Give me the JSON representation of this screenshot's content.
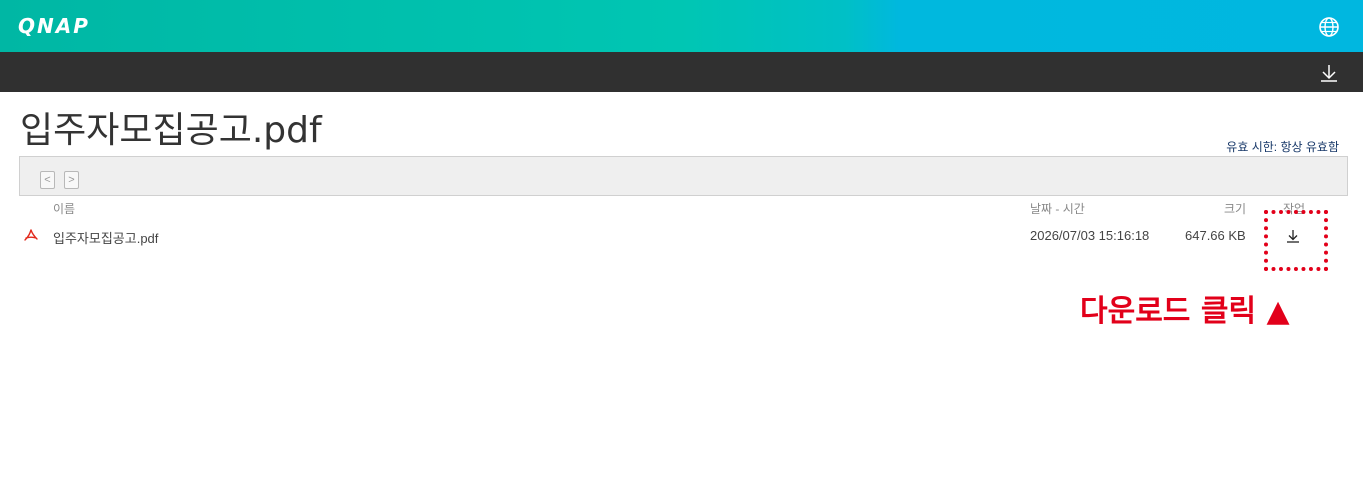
{
  "brand": {
    "logo_text": "QNAP"
  },
  "header": {
    "globe_icon": "globe-icon",
    "download_icon": "download-icon"
  },
  "page": {
    "title": "입주자모집공고.pdf",
    "expiry": "유효 시한: 항상 유효함"
  },
  "nav": {
    "prev_label": "<",
    "next_label": ">"
  },
  "table": {
    "columns": {
      "name": "이름",
      "datetime": "날짜 - 시간",
      "size": "크기",
      "action": "작업"
    },
    "rows": [
      {
        "icon": "pdf-icon",
        "name": "입주자모집공고.pdf",
        "datetime": "2026/07/03 15:16:18",
        "size": "647.66 KB"
      }
    ]
  },
  "annotation": {
    "text": "다운로드 클릭 ▲",
    "color": "#e2001a"
  },
  "colors": {
    "teal": "#00c6b3",
    "blue": "#00b7e0",
    "toolbar": "#303030"
  }
}
